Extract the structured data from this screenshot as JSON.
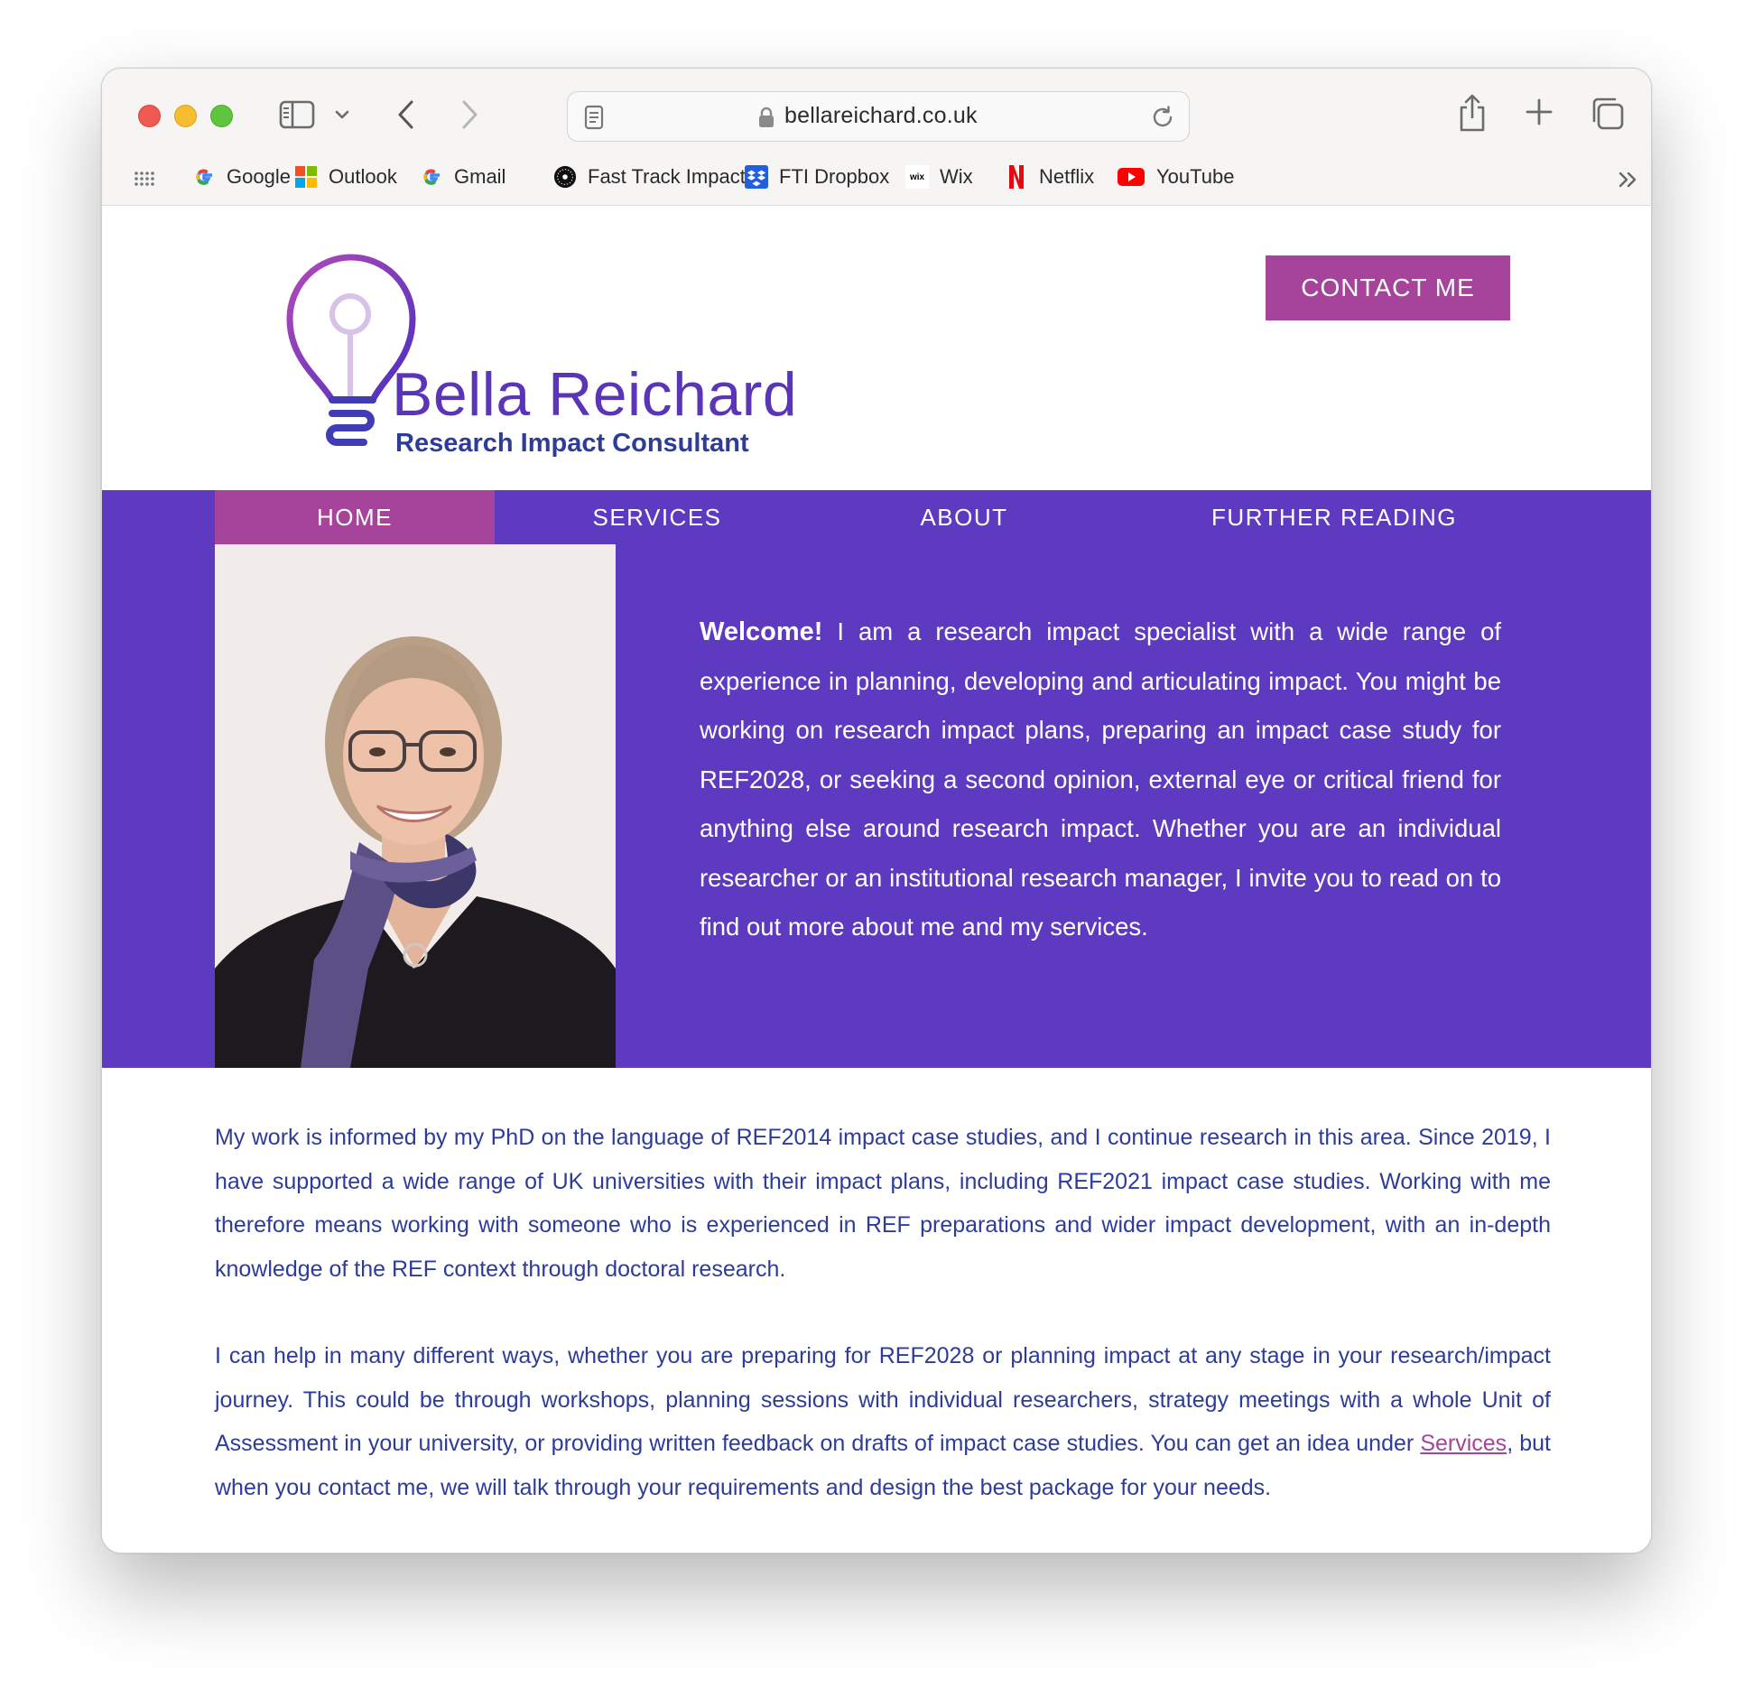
{
  "browser": {
    "url": "bellareichard.co.uk",
    "bookmarks": [
      {
        "label": "Google",
        "icon": "google-icon"
      },
      {
        "label": "Outlook",
        "icon": "outlook-icon"
      },
      {
        "label": "Gmail",
        "icon": "google-icon"
      },
      {
        "label": "Fast Track Impact",
        "icon": "fast-track-impact-icon"
      },
      {
        "label": "FTI Dropbox",
        "icon": "dropbox-icon"
      },
      {
        "label": "Wix",
        "icon": "wix-icon"
      },
      {
        "label": "Netflix",
        "icon": "netflix-icon"
      },
      {
        "label": "YouTube",
        "icon": "youtube-icon"
      }
    ]
  },
  "site": {
    "brand_name": "Bella Reichard",
    "brand_tagline": "Research Impact Consultant",
    "contact_label": "CONTACT ME",
    "nav": [
      {
        "label": "HOME",
        "active": true
      },
      {
        "label": "SERVICES",
        "active": false
      },
      {
        "label": "ABOUT",
        "active": false
      },
      {
        "label": "FURTHER READING",
        "active": false
      }
    ],
    "welcome_lead": "Welcome!",
    "welcome_text": " I am a research impact specialist with a wide range of experience in planning, developing and articulating impact. You might be working on research impact plans, preparing an impact case study for REF2028, or seeking a second opinion, external eye or critical friend for anything else around research impact. Whether you are an individual researcher or an institutional research manager, I invite you to read on to find out more about me and my services.",
    "para1": "My work is informed by my PhD on the language of REF2014 impact case studies, and I continue research in this area. Since 2019, I have supported a wide range of UK universities with their impact plans, including REF2021 impact case studies. Working with me therefore means working with someone who is experienced in REF preparations and wider impact development, with an in-depth knowledge of the REF context through doctoral research.",
    "para2_before": "I can help in many different ways, whether you are preparing for REF2028 or planning impact at any stage in your research/impact journey. This could be through workshops, planning sessions with individual researchers, strategy meetings with a whole Unit of Assessment in your university, or providing written feedback on drafts of impact case studies. You can get an idea under ",
    "para2_link": "Services",
    "para2_after": ", but when you contact me, we will talk through your requirements and design the best package for your needs."
  },
  "colors": {
    "purple": "#5e3ac0",
    "magenta": "#a5449a",
    "text_blue": "#2e3c99"
  }
}
